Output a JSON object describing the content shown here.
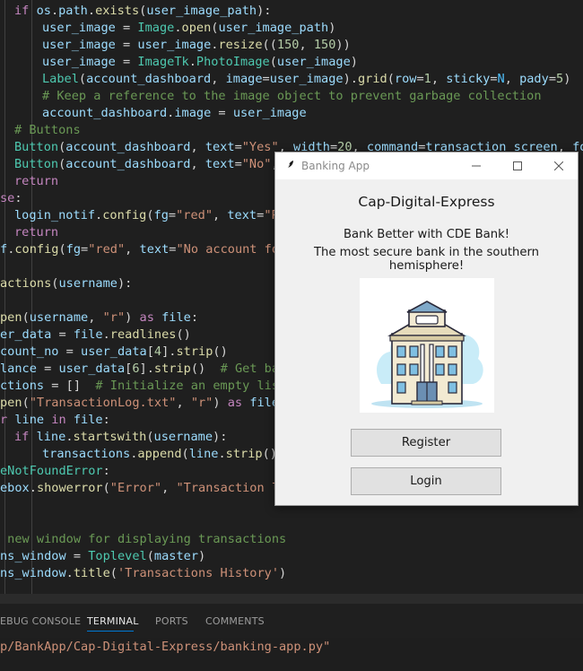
{
  "editor": {
    "lines": [
      [
        [
          "kw",
          "if "
        ],
        [
          "var",
          "os"
        ],
        [
          "op",
          "."
        ],
        [
          "var",
          "path"
        ],
        [
          "op",
          "."
        ],
        [
          "fn",
          "exists"
        ],
        [
          "op",
          "("
        ],
        [
          "var",
          "user_image_path"
        ],
        [
          "op",
          "):"
        ]
      ],
      [
        [
          "var",
          "user_image"
        ],
        [
          "op",
          " = "
        ],
        [
          "cls",
          "Image"
        ],
        [
          "op",
          "."
        ],
        [
          "fn",
          "open"
        ],
        [
          "op",
          "("
        ],
        [
          "var",
          "user_image_path"
        ],
        [
          "op",
          ")"
        ]
      ],
      [
        [
          "var",
          "user_image"
        ],
        [
          "op",
          " = "
        ],
        [
          "var",
          "user_image"
        ],
        [
          "op",
          "."
        ],
        [
          "fn",
          "resize"
        ],
        [
          "op",
          "(("
        ],
        [
          "num",
          "150"
        ],
        [
          "op",
          ", "
        ],
        [
          "num",
          "150"
        ],
        [
          "op",
          "))"
        ]
      ],
      [
        [
          "var",
          "user_image"
        ],
        [
          "op",
          " = "
        ],
        [
          "cls",
          "ImageTk"
        ],
        [
          "op",
          "."
        ],
        [
          "cls",
          "PhotoImage"
        ],
        [
          "op",
          "("
        ],
        [
          "var",
          "user_image"
        ],
        [
          "op",
          ")"
        ]
      ],
      [
        [
          "cls",
          "Label"
        ],
        [
          "op",
          "("
        ],
        [
          "var",
          "account_dashboard"
        ],
        [
          "op",
          ", "
        ],
        [
          "var",
          "image"
        ],
        [
          "op",
          "="
        ],
        [
          "var",
          "user_image"
        ],
        [
          "op",
          ")."
        ],
        [
          "fn",
          "grid"
        ],
        [
          "op",
          "("
        ],
        [
          "var",
          "row"
        ],
        [
          "op",
          "="
        ],
        [
          "num",
          "1"
        ],
        [
          "op",
          ", "
        ],
        [
          "var",
          "sticky"
        ],
        [
          "op",
          "="
        ],
        [
          "const",
          "N"
        ],
        [
          "op",
          ", "
        ],
        [
          "var",
          "pady"
        ],
        [
          "op",
          "="
        ],
        [
          "num",
          "5"
        ],
        [
          "op",
          ")"
        ]
      ],
      [
        [
          "cm",
          "# Keep a reference to the image object to prevent garbage collection"
        ]
      ],
      [
        [
          "var",
          "account_dashboard"
        ],
        [
          "op",
          "."
        ],
        [
          "var",
          "image"
        ],
        [
          "op",
          " = "
        ],
        [
          "var",
          "user_image"
        ]
      ],
      [
        [
          "cm",
          "# Buttons"
        ]
      ],
      [
        [
          "cls",
          "Button"
        ],
        [
          "op",
          "("
        ],
        [
          "var",
          "account_dashboard"
        ],
        [
          "op",
          ", "
        ],
        [
          "var",
          "text"
        ],
        [
          "op",
          "="
        ],
        [
          "str",
          "\"Yes\""
        ],
        [
          "op",
          ", "
        ],
        [
          "var",
          "width"
        ],
        [
          "op",
          "="
        ],
        [
          "num",
          "20"
        ],
        [
          "op",
          ", "
        ],
        [
          "var",
          "command"
        ],
        [
          "op",
          "="
        ],
        [
          "var",
          "transaction_screen"
        ],
        [
          "op",
          ", "
        ],
        [
          "var",
          "font"
        ],
        [
          "op",
          "=("
        ]
      ],
      [
        [
          "cls",
          "Button"
        ],
        [
          "op",
          "("
        ],
        [
          "var",
          "account_dashboard"
        ],
        [
          "op",
          ", "
        ],
        [
          "var",
          "text"
        ],
        [
          "op",
          "="
        ],
        [
          "str",
          "\"No\""
        ],
        [
          "op",
          ", "
        ],
        [
          "var",
          "w"
        ]
      ],
      [
        [
          "kw",
          "return"
        ]
      ],
      [
        [
          "kw",
          "se"
        ],
        [
          "op",
          ":"
        ]
      ],
      [
        [
          "var",
          "login_notif"
        ],
        [
          "op",
          "."
        ],
        [
          "fn",
          "config"
        ],
        [
          "op",
          "("
        ],
        [
          "var",
          "fg"
        ],
        [
          "op",
          "="
        ],
        [
          "str",
          "\"red\""
        ],
        [
          "op",
          ", "
        ],
        [
          "var",
          "text"
        ],
        [
          "op",
          "="
        ],
        [
          "str",
          "\"Pas"
        ]
      ],
      [
        [
          "kw",
          "return"
        ]
      ],
      [
        [
          "var",
          "f"
        ],
        [
          "op",
          "."
        ],
        [
          "fn",
          "config"
        ],
        [
          "op",
          "("
        ],
        [
          "var",
          "fg"
        ],
        [
          "op",
          "="
        ],
        [
          "str",
          "\"red\""
        ],
        [
          "op",
          ", "
        ],
        [
          "var",
          "text"
        ],
        [
          "op",
          "="
        ],
        [
          "str",
          "\"No account foun"
        ]
      ],
      [],
      [
        [
          "fn",
          "actions"
        ],
        [
          "op",
          "("
        ],
        [
          "var",
          "username"
        ],
        [
          "op",
          "):"
        ]
      ],
      [],
      [
        [
          "fn",
          "pen"
        ],
        [
          "op",
          "("
        ],
        [
          "var",
          "username"
        ],
        [
          "op",
          ", "
        ],
        [
          "str",
          "\"r\""
        ],
        [
          "op",
          ") "
        ],
        [
          "kw",
          "as"
        ],
        [
          "op",
          " "
        ],
        [
          "var",
          "file"
        ],
        [
          "op",
          ":"
        ]
      ],
      [
        [
          "var",
          "er_data"
        ],
        [
          "op",
          " = "
        ],
        [
          "var",
          "file"
        ],
        [
          "op",
          "."
        ],
        [
          "fn",
          "readlines"
        ],
        [
          "op",
          "()"
        ]
      ],
      [
        [
          "var",
          "count_no"
        ],
        [
          "op",
          " = "
        ],
        [
          "var",
          "user_data"
        ],
        [
          "op",
          "["
        ],
        [
          "num",
          "4"
        ],
        [
          "op",
          "]."
        ],
        [
          "fn",
          "strip"
        ],
        [
          "op",
          "()"
        ]
      ],
      [
        [
          "var",
          "lance"
        ],
        [
          "op",
          " = "
        ],
        [
          "var",
          "user_data"
        ],
        [
          "op",
          "["
        ],
        [
          "num",
          "6"
        ],
        [
          "op",
          "]."
        ],
        [
          "fn",
          "strip"
        ],
        [
          "op",
          "()  "
        ],
        [
          "cm",
          "# Get bala"
        ]
      ],
      [
        [
          "var",
          "ctions"
        ],
        [
          "op",
          " = []  "
        ],
        [
          "cm",
          "# Initialize an empty list"
        ]
      ],
      [
        [
          "fn",
          "pen"
        ],
        [
          "op",
          "("
        ],
        [
          "str",
          "\"TransactionLog.txt\""
        ],
        [
          "op",
          ", "
        ],
        [
          "str",
          "\"r\""
        ],
        [
          "op",
          ") "
        ],
        [
          "kw",
          "as"
        ],
        [
          "op",
          " "
        ],
        [
          "var",
          "file"
        ],
        [
          "op",
          ":"
        ]
      ],
      [
        [
          "kw",
          "r "
        ],
        [
          "var",
          "line"
        ],
        [
          "kw",
          " in "
        ],
        [
          "var",
          "file"
        ],
        [
          "op",
          ":"
        ]
      ],
      [
        [
          "kw",
          "if "
        ],
        [
          "var",
          "line"
        ],
        [
          "op",
          "."
        ],
        [
          "fn",
          "startswith"
        ],
        [
          "op",
          "("
        ],
        [
          "var",
          "username"
        ],
        [
          "op",
          "):"
        ]
      ],
      [
        [
          "var",
          "transactions"
        ],
        [
          "op",
          "."
        ],
        [
          "fn",
          "append"
        ],
        [
          "op",
          "("
        ],
        [
          "var",
          "line"
        ],
        [
          "op",
          "."
        ],
        [
          "fn",
          "strip"
        ],
        [
          "op",
          "()"
        ]
      ],
      [
        [
          "cls",
          "eNotFoundError"
        ],
        [
          "op",
          ":"
        ]
      ],
      [
        [
          "var",
          "ebox"
        ],
        [
          "op",
          "."
        ],
        [
          "fn",
          "showerror"
        ],
        [
          "op",
          "("
        ],
        [
          "str",
          "\"Error\""
        ],
        [
          "op",
          ", "
        ],
        [
          "str",
          "\"Transaction log"
        ]
      ],
      [],
      [],
      [
        [
          "cm",
          " new window for displaying transactions"
        ]
      ],
      [
        [
          "var",
          "ns_window"
        ],
        [
          "op",
          " = "
        ],
        [
          "cls",
          "Toplevel"
        ],
        [
          "op",
          "("
        ],
        [
          "var",
          "master"
        ],
        [
          "op",
          ")"
        ]
      ],
      [
        [
          "var",
          "ns_window"
        ],
        [
          "op",
          "."
        ],
        [
          "fn",
          "title"
        ],
        [
          "op",
          "("
        ],
        [
          "str",
          "'Transactions History'"
        ],
        [
          "op",
          ")"
        ]
      ]
    ]
  },
  "panel": {
    "tabs": [
      "EBUG CONSOLE",
      "TERMINAL",
      "PORTS",
      "COMMENTS"
    ],
    "active_tab": "TERMINAL",
    "terminal_line": "p/BankApp/Cap-Digital-Express/banking-app.py\""
  },
  "tk_window": {
    "title": "Banking App",
    "heading": "Cap-Digital-Express",
    "tagline_1": "Bank Better with CDE Bank!",
    "tagline_2": "The most secure bank in the southern hemisphere!",
    "register_label": "Register",
    "login_label": "Login",
    "image_icon": "bank-building-icon"
  }
}
